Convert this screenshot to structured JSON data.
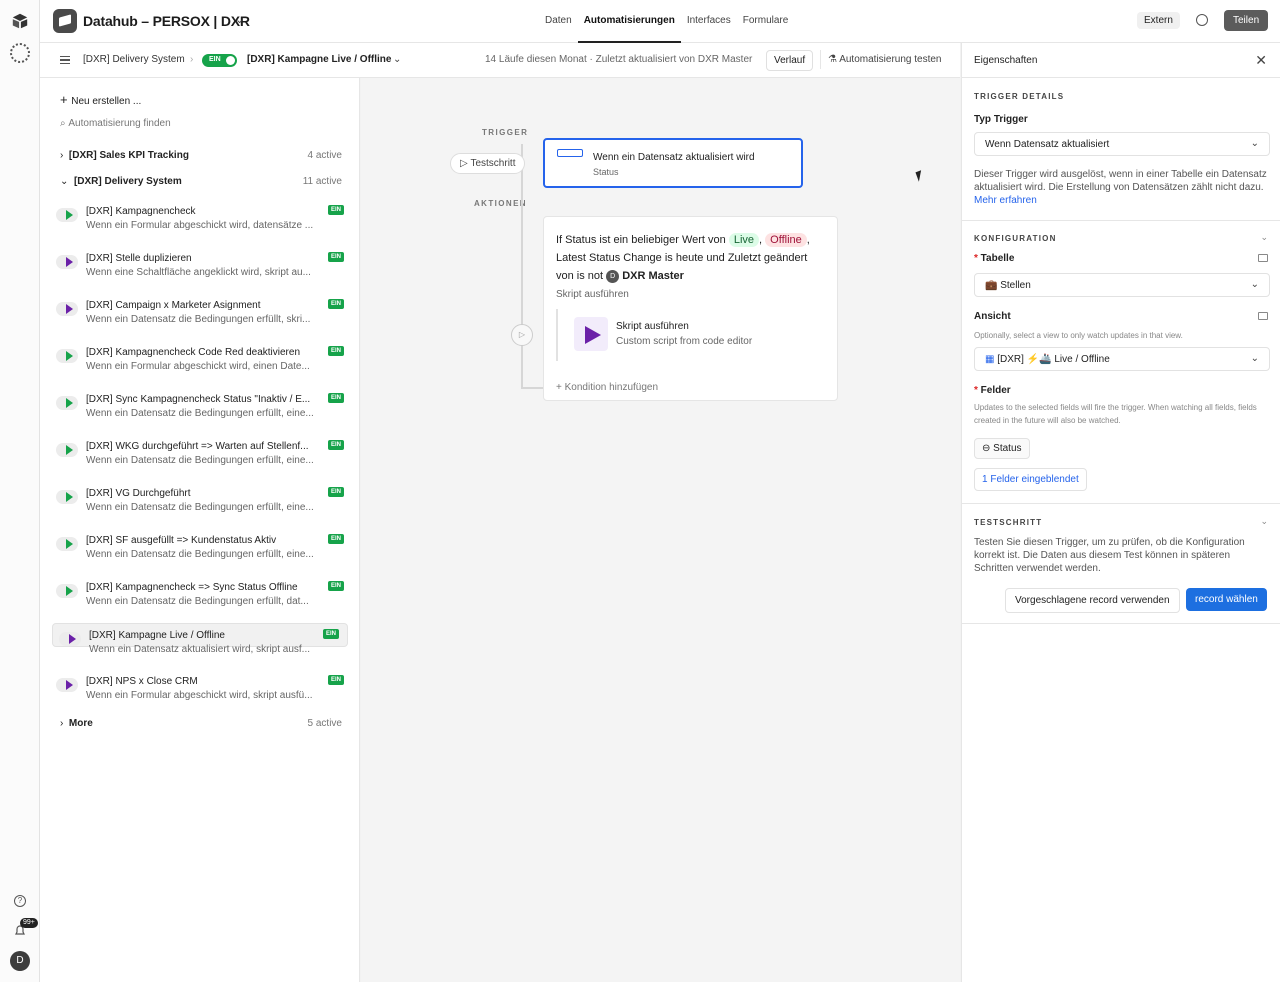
{
  "app": {
    "title": "Datahub – PERSOX | DXR"
  },
  "nav": [
    "Daten",
    "Automatisierungen",
    "Interfaces",
    "Formulare"
  ],
  "topright": {
    "extern": "Extern",
    "share": "Teilen"
  },
  "rail": {
    "badge": "99+",
    "avatar": "D"
  },
  "subbar": {
    "crumb1": "[DXR] Delivery System",
    "toggle": "EIN",
    "crumb2": "[DXR] Kampagne Live / Offline",
    "runs": "14 Läufe diesen Monat · Zuletzt aktualisiert von DXR Master",
    "verlauf": "Verlauf",
    "test": "Automatisierung testen"
  },
  "sidebar": {
    "new": "Neu erstellen ...",
    "search_placeholder": "Automatisierung finden",
    "groups": [
      {
        "name": "[DXR] Sales KPI Tracking",
        "count": "4 active"
      },
      {
        "name": "[DXR] Delivery System",
        "count": "11 active"
      },
      {
        "name": "More",
        "count": "5 active"
      }
    ],
    "badge": "EIN",
    "items": [
      {
        "title": "[DXR] Kampagnencheck",
        "desc": "Wenn ein Formular abgeschickt wird, datensätze ..."
      },
      {
        "title": "[DXR] Stelle duplizieren",
        "desc": "Wenn eine Schaltfläche angeklickt wird, skript au..."
      },
      {
        "title": "[DXR] Campaign x Marketer Asignment",
        "desc": "Wenn ein Datensatz die Bedingungen erfüllt, skri..."
      },
      {
        "title": "[DXR] Kampagnencheck Code Red deaktivieren",
        "desc": "Wenn ein Formular abgeschickt wird, einen Date..."
      },
      {
        "title": "[DXR] Sync Kampagnencheck Status \"Inaktiv / E...",
        "desc": "Wenn ein Datensatz die Bedingungen erfüllt, eine..."
      },
      {
        "title": "[DXR] WKG durchgeführt => Warten auf Stellenf...",
        "desc": "Wenn ein Datensatz die Bedingungen erfüllt, eine..."
      },
      {
        "title": "[DXR] VG Durchgeführt",
        "desc": "Wenn ein Datensatz die Bedingungen erfüllt, eine..."
      },
      {
        "title": "[DXR] SF ausgefüllt => Kundenstatus Aktiv",
        "desc": "Wenn ein Datensatz die Bedingungen erfüllt, eine..."
      },
      {
        "title": "[DXR] Kampagnencheck => Sync Status Offline",
        "desc": "Wenn ein Datensatz die Bedingungen erfüllt, dat..."
      },
      {
        "title": "[DXR] Kampagne Live / Offline",
        "desc": "Wenn ein Datensatz aktualisiert wird, skript ausf..."
      },
      {
        "title": "[DXR] NPS x Close CRM",
        "desc": "Wenn ein Formular abgeschickt wird, skript ausfü..."
      }
    ]
  },
  "canvas": {
    "trigger_label": "TRIGGER",
    "actions_label": "AKTIONEN",
    "testschritt": "Testschritt",
    "trigger_title": "Wenn ein Datensatz aktualisiert wird",
    "trigger_sub": "Status",
    "cond_a": "If Status ist ein beliebiger Wert von",
    "cond_live": "Live",
    "cond_off": "Offline",
    "cond_b": ", Latest Status Change is heute und Zuletzt geändert von is not",
    "cond_user": "DXR Master",
    "cond_user_initial": "D",
    "skript_label": "Skript ausführen",
    "skript_title": "Skript ausführen",
    "skript_sub": "Custom script from code editor",
    "add_condition": "Kondition hinzufügen"
  },
  "panel": {
    "title": "Eigenschaften",
    "trigger_details": "TRIGGER DETAILS",
    "typ_label": "Typ Trigger",
    "typ_value": "Wenn Datensatz aktualisiert",
    "typ_desc": "Dieser Trigger wird ausgelöst, wenn in einer Tabelle ein Datensatz aktualisiert wird. Die Erstellung von Datensätzen zählt nicht dazu.",
    "learn_more": "Mehr erfahren",
    "konfiguration": "KONFIGURATION",
    "tabelle_label": "Tabelle",
    "tabelle_value": "💼 Stellen",
    "ansicht_label": "Ansicht",
    "ansicht_hint": "Optionally, select a view to only watch updates in that view.",
    "ansicht_value": "[DXR] ⚡️🚢 Live / Offline",
    "felder_label": "Felder",
    "felder_hint": "Updates to the selected fields will fire the trigger. When watching all fields, fields created in the future will also be watched.",
    "status_chip": "Status",
    "felder_shown": "1 Felder eingeblendet",
    "testschritt": "TESTSCHRITT",
    "test_desc": "Testen Sie diesen Trigger, um zu prüfen, ob die Konfiguration korrekt ist. Die Daten aus diesem Test können in späteren Schritten verwendet werden.",
    "btn_suggested": "Vorgeschlagene record verwenden",
    "btn_choose": "record wählen"
  }
}
